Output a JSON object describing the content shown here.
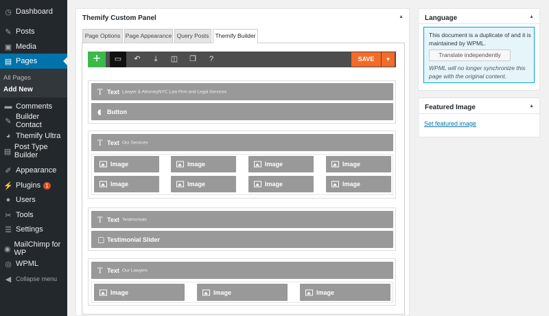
{
  "sidebar": {
    "items": [
      {
        "label": "Dashboard",
        "icon": "dashboard-icon",
        "glyph": "◷"
      },
      {
        "label": "Posts",
        "icon": "pin-icon",
        "glyph": "✎"
      },
      {
        "label": "Media",
        "icon": "media-icon",
        "glyph": "▣"
      },
      {
        "label": "Pages",
        "icon": "pages-icon",
        "glyph": "▤"
      },
      {
        "label": "Comments",
        "icon": "comments-icon",
        "glyph": "▬"
      },
      {
        "label": "Builder Contact",
        "icon": "pin-icon",
        "glyph": "✎"
      },
      {
        "label": "Themify Ultra",
        "icon": "themify-icon",
        "glyph": "◕"
      },
      {
        "label": "Post Type Builder",
        "icon": "post-type-icon",
        "glyph": "▤"
      },
      {
        "label": "Appearance",
        "icon": "brush-icon",
        "glyph": "✐"
      },
      {
        "label": "Plugins",
        "icon": "plugin-icon",
        "glyph": "⚡",
        "badge": "1"
      },
      {
        "label": "Users",
        "icon": "user-icon",
        "glyph": "●"
      },
      {
        "label": "Tools",
        "icon": "wrench-icon",
        "glyph": "✂"
      },
      {
        "label": "Settings",
        "icon": "settings-icon",
        "glyph": "☰"
      },
      {
        "label": "MailChimp for WP",
        "icon": "mailchimp-icon",
        "glyph": "◉"
      },
      {
        "label": "WPML",
        "icon": "wpml-icon",
        "glyph": "◎"
      }
    ],
    "submenu": [
      "All Pages",
      "Add New"
    ],
    "collapse_label": "Collapse menu"
  },
  "panel": {
    "title": "Themify Custom Panel",
    "tabs": [
      "Page Options",
      "Page Appearance",
      "Query Posts",
      "Themify Builder"
    ],
    "active_tab": "Themify Builder"
  },
  "toolbar": {
    "add_label": "+",
    "help_label": "?",
    "save_label": "SAVE",
    "dropdown_label": "▾"
  },
  "rows": [
    {
      "text_module": {
        "name": "Text",
        "desc": "Lawyer & AttorneyNYC Law Firm and Legal Services"
      },
      "button_module": {
        "name": "Button"
      }
    },
    {
      "text_module": {
        "name": "Text",
        "desc": "Our Services"
      },
      "images": [
        "Image",
        "Image",
        "Image",
        "Image",
        "Image",
        "Image",
        "Image",
        "Image"
      ]
    },
    {
      "text_module": {
        "name": "Text",
        "desc": "Testimonials"
      },
      "slider_module": {
        "name": "Testimonial Slider"
      }
    },
    {
      "text_module": {
        "name": "Text",
        "desc": "Our Lawyers"
      },
      "images": [
        "Image",
        "Image",
        "Image"
      ]
    }
  ],
  "language_box": {
    "title": "Language",
    "notice": "This document is a duplicate of and it is maintained by WPML.",
    "button": "Translate independently",
    "note": "WPML will no longer synchronize this page with the original content."
  },
  "featured_box": {
    "title": "Featured Image",
    "link": "Set featured image"
  },
  "colors": {
    "sidebar_bg": "#23282d",
    "active_menu": "#0073aa",
    "add_button": "#3cb94b",
    "save_button": "#f36b28",
    "module_bg": "#999999"
  }
}
